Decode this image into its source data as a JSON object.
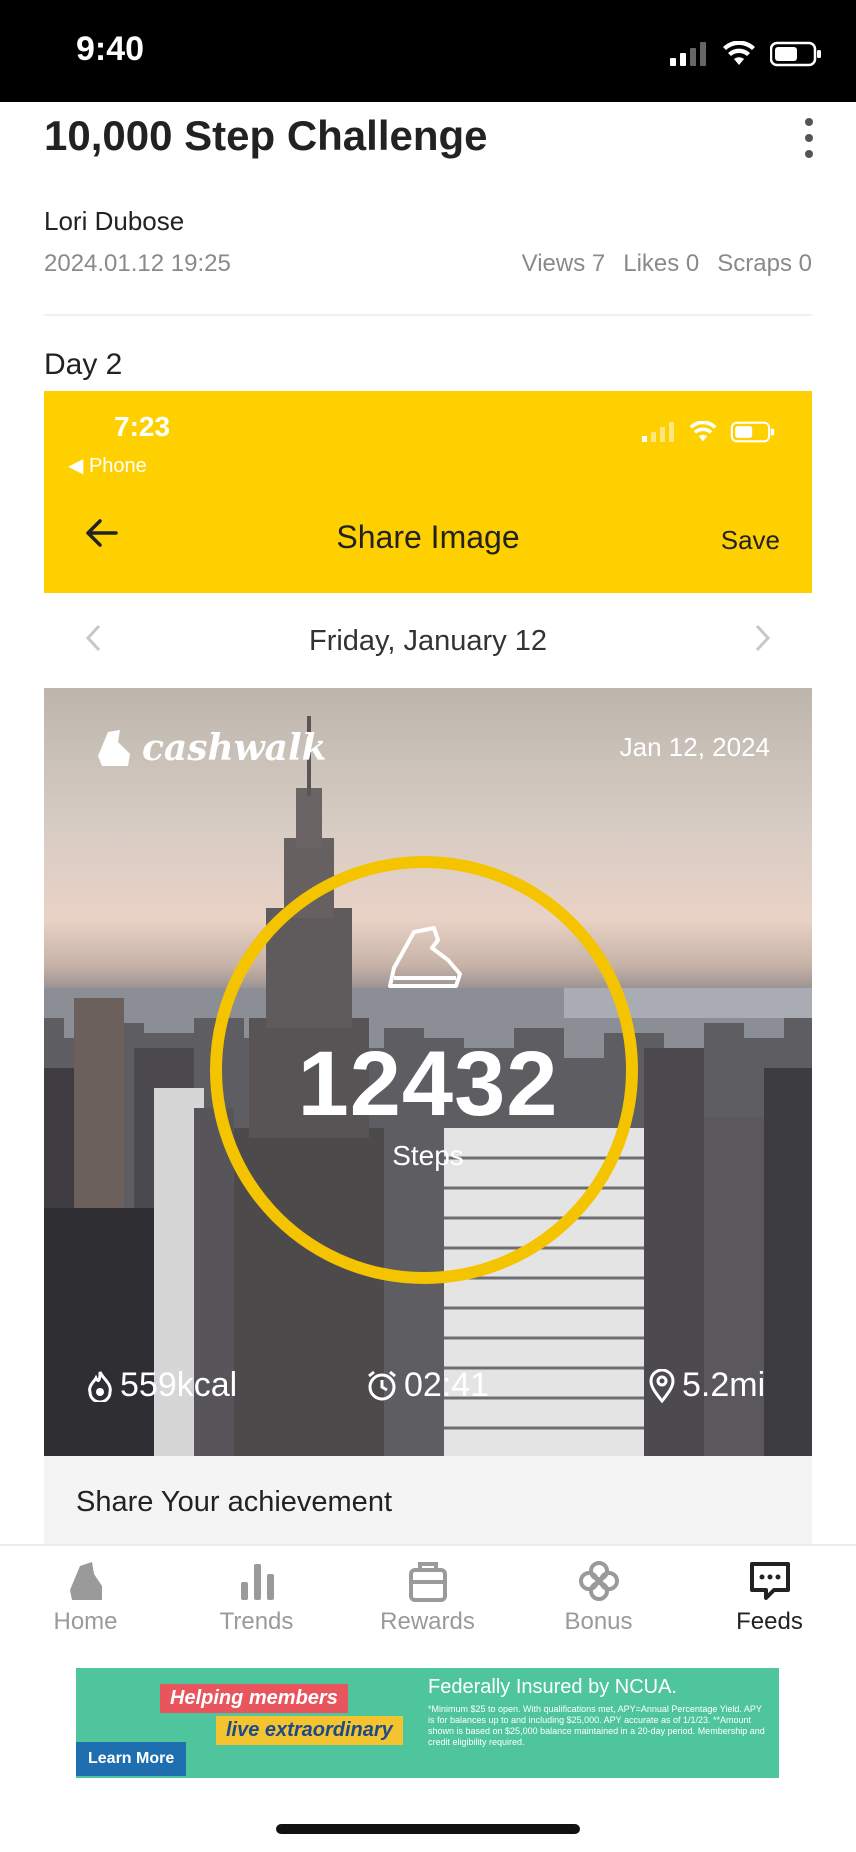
{
  "status_bar": {
    "time": "9:40"
  },
  "post": {
    "title": "10,000 Step Challenge",
    "author": "Lori Dubose",
    "date": "2024.01.12 19:25",
    "stats": {
      "views": "Views 7",
      "likes": "Likes 0",
      "scraps": "Scraps 0"
    },
    "day_label": "Day 2"
  },
  "embedded_screen": {
    "status_time": "7:23",
    "back_app": "◀ Phone",
    "header_title": "Share Image",
    "save_label": "Save",
    "date_label": "Friday, January 12",
    "card": {
      "brand": "cashwalk",
      "date": "Jan 12, 2024",
      "steps_value": "12432",
      "steps_label": "Steps",
      "calories": "559kcal",
      "duration": "02:41",
      "distance": "5.2mi"
    },
    "share_section_title": "Share Your achievement"
  },
  "bottom_nav": {
    "items": [
      {
        "label": "Home",
        "icon": "shoe-icon"
      },
      {
        "label": "Trends",
        "icon": "bar-chart-icon"
      },
      {
        "label": "Rewards",
        "icon": "bag-icon"
      },
      {
        "label": "Bonus",
        "icon": "clover-icon"
      },
      {
        "label": "Feeds",
        "icon": "chat-icon"
      }
    ],
    "active": "Feeds"
  },
  "ad": {
    "headline1": "Helping members",
    "headline2": "live extraordinary",
    "insured": "Federally Insured by NCUA.",
    "fine_print": "*Minimum $25 to open. With qualifications met, APY=Annual Percentage Yield. APY is for balances up to and including $25,000. APY accurate as of 1/1/23. **Amount shown is based on $25,000 balance maintained in a 20-day period. Membership and credit eligibility required.",
    "cta": "Learn More"
  },
  "colors": {
    "accent": "#ffd000",
    "ring": "#f5c400",
    "ad_bg": "#4fc59e"
  }
}
